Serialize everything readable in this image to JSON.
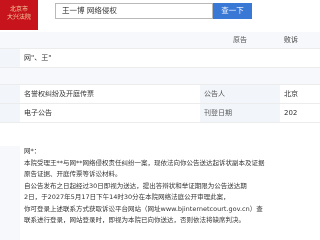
{
  "header": {
    "logo_text": "北京市\n大兴法院",
    "search_query": "王一博 网络侵权",
    "search_button": "查一下"
  },
  "table": {
    "row1": {
      "c3": "原告",
      "c4": "败诉"
    },
    "row2": {
      "c2": "网\"、王\""
    },
    "row3": {
      "c1": "名誉权纠纷及开庭传票",
      "c3": "公告人",
      "c4": "北京"
    },
    "row4": {
      "c1": "电子公告",
      "c3": "刊登日期",
      "c4": "202"
    }
  },
  "notice": {
    "lines": [
      "网*：",
      "本院受理王**与网**网络侵权责任纠纷一案，现依法向你公告送达起诉状副本及证据",
      "原告证据、开庭传票等诉讼材料。",
      "自公告发布之日起经过30日即视为送达，提出答辩状和举证期限为公告送达期",
      "2日，于2027年5月17日下午14时30分在本院网络法庭公开审理此案，",
      "你可登录上述联系方式获取诉讼平台网站（网址www.bjinternetcourt.gov.cn）查",
      "联系进行登录，网站登录时，即视为本院已向你送达，否则依法将缺席判决。"
    ]
  }
}
